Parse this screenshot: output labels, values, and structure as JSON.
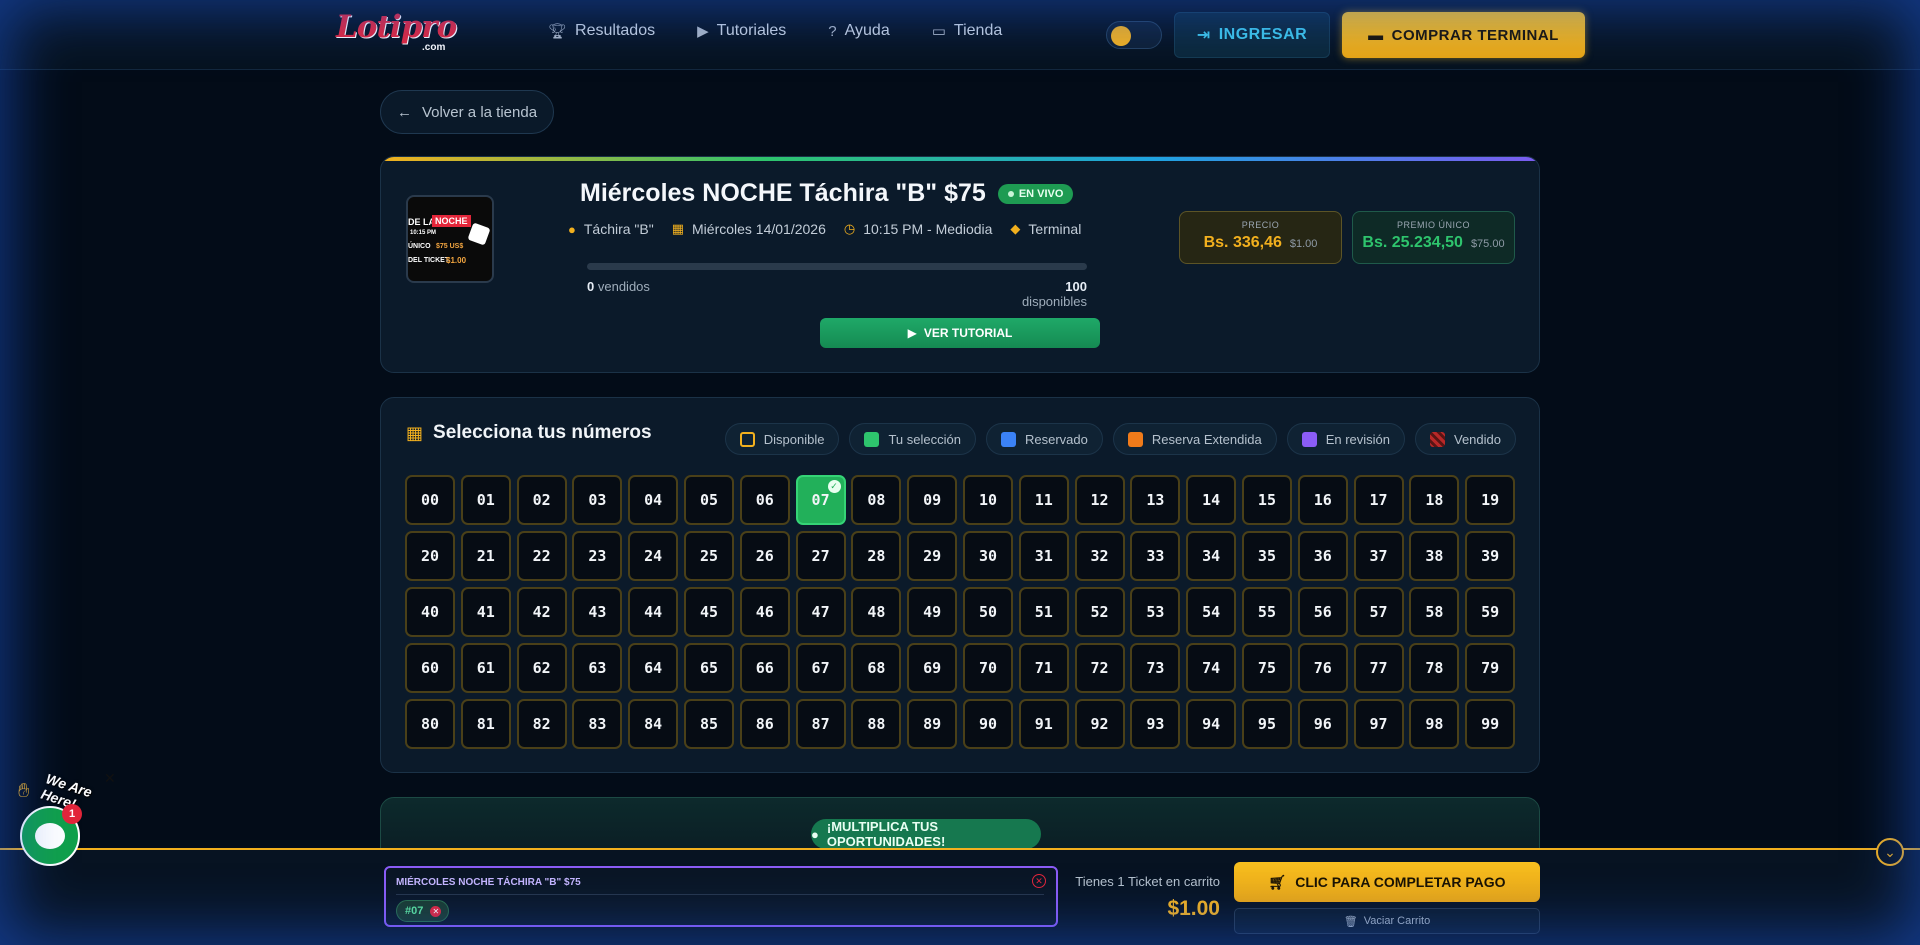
{
  "header": {
    "logo": "Lotipro",
    "logo_sub": ".com",
    "nav": [
      {
        "label": "Resultados",
        "icon": "trophy-icon"
      },
      {
        "label": "Tutoriales",
        "icon": "play-circle-icon"
      },
      {
        "label": "Ayuda",
        "icon": "question-circle-icon"
      },
      {
        "label": "Tienda",
        "icon": "ticket-icon"
      }
    ],
    "login_label": "INGRESAR",
    "buy_label": "COMPRAR TERMINAL"
  },
  "back_label": "Volver a la tienda",
  "event": {
    "title": "Miércoles NOCHE Táchira \"B\" $75",
    "live_label": "EN VIVO",
    "thumb": {
      "line1": "DE LA",
      "line1b": "NOCHE",
      "line2": "10:15 PM",
      "line3": "ÚNICO",
      "line3b": "$75 US$",
      "line4": "DEL TICKET",
      "line4b": "$1.00"
    },
    "meta": [
      {
        "icon": "coins-icon",
        "text": "Táchira \"B\""
      },
      {
        "icon": "calendar-icon",
        "text": "Miércoles 14/01/2026"
      },
      {
        "icon": "clock-icon",
        "text": "10:15 PM - Mediodia"
      },
      {
        "icon": "tag-icon",
        "text": "Terminal"
      }
    ],
    "sold_count": "0",
    "sold_label": "vendidos",
    "available_count": "100",
    "available_label": "disponibles",
    "progress_fraction": 0,
    "tutorial_label": "VER TUTORIAL",
    "price": {
      "label": "PRECIO",
      "bs": "Bs. 336,46",
      "usd": "$1.00"
    },
    "prize": {
      "label": "PREMIO ÚNICO",
      "bs": "Bs. 25.234,50",
      "usd": "$75.00"
    }
  },
  "grid": {
    "title": "Selecciona tus números",
    "legend": [
      {
        "label": "Disponible",
        "swatch": "avail-sw"
      },
      {
        "label": "Tu selección",
        "swatch": "sel"
      },
      {
        "label": "Reservado",
        "swatch": "res"
      },
      {
        "label": "Reserva Extendida",
        "swatch": "ext"
      },
      {
        "label": "En revisión",
        "swatch": "rev"
      },
      {
        "label": "Vendido",
        "swatch": "sold-sw"
      }
    ],
    "numbers": [
      "00",
      "01",
      "02",
      "03",
      "04",
      "05",
      "06",
      "07",
      "08",
      "09",
      "10",
      "11",
      "12",
      "13",
      "14",
      "15",
      "16",
      "17",
      "18",
      "19",
      "20",
      "21",
      "22",
      "23",
      "24",
      "25",
      "26",
      "27",
      "28",
      "29",
      "30",
      "31",
      "32",
      "33",
      "34",
      "35",
      "36",
      "37",
      "38",
      "39",
      "40",
      "41",
      "42",
      "43",
      "44",
      "45",
      "46",
      "47",
      "48",
      "49",
      "50",
      "51",
      "52",
      "53",
      "54",
      "55",
      "56",
      "57",
      "58",
      "59",
      "60",
      "61",
      "62",
      "63",
      "64",
      "65",
      "66",
      "67",
      "68",
      "69",
      "70",
      "71",
      "72",
      "73",
      "74",
      "75",
      "76",
      "77",
      "78",
      "79",
      "80",
      "81",
      "82",
      "83",
      "84",
      "85",
      "86",
      "87",
      "88",
      "89",
      "90",
      "91",
      "92",
      "93",
      "94",
      "95",
      "96",
      "97",
      "98",
      "99"
    ],
    "selected": [
      "07"
    ]
  },
  "multiply_label": "¡MULTIPLICA TUS OPORTUNIDADES!",
  "cart": {
    "item_title": "MIÉRCOLES NOCHE TÁCHIRA \"B\" $75",
    "chip": "#07",
    "count_text": "Tienes 1 Ticket en carrito",
    "total": "$1.00",
    "pay_label": "CLIC PARA COMPLETAR PAGO",
    "empty_label": "Vaciar Carrito"
  },
  "chat": {
    "text": "We Are Here!",
    "badge": "1"
  },
  "colors": {
    "accent_gold": "#f2b01e",
    "accent_green": "#2ec46d",
    "accent_purple": "#8b5cf6",
    "brand_red": "#e3263a"
  }
}
